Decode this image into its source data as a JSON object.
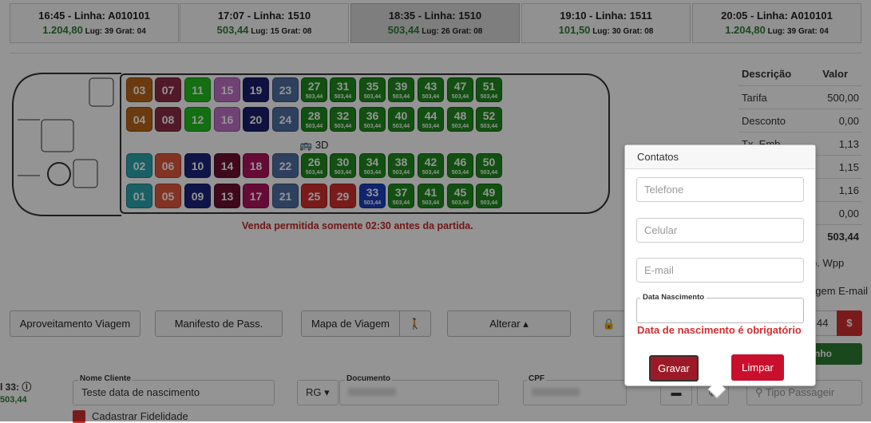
{
  "trips": [
    {
      "time_line": "16:45 - Linha: A010101",
      "price": "1.204,80",
      "lug": "39",
      "grat": "04",
      "active": false
    },
    {
      "time_line": "17:07 - Linha: 1510",
      "price": "503,44",
      "lug": "15",
      "grat": "08",
      "active": false
    },
    {
      "time_line": "18:35 - Linha: 1510",
      "price": "503,44",
      "lug": "26",
      "grat": "08",
      "active": true
    },
    {
      "time_line": "19:10 - Linha: 1511",
      "price": "101,50",
      "lug": "30",
      "grat": "08",
      "active": false
    },
    {
      "time_line": "20:05 - Linha: A010101",
      "price": "1.204,80",
      "lug": "39",
      "grat": "04",
      "active": false
    }
  ],
  "trip_labels": {
    "lug": "Lug:",
    "grat": "Grat:"
  },
  "seat_price": "503,44",
  "seats": [
    {
      "n": "03",
      "color": "#b8671a"
    },
    {
      "n": "04",
      "color": "#b8671a"
    },
    {
      "n": "07",
      "color": "#8e2d48"
    },
    {
      "n": "08",
      "color": "#8e2d48"
    },
    {
      "n": "11",
      "color": "#22c01e"
    },
    {
      "n": "12",
      "color": "#22c01e"
    },
    {
      "n": "15",
      "color": "#c173c8"
    },
    {
      "n": "16",
      "color": "#c173c8"
    },
    {
      "n": "19",
      "color": "#1a1f6e"
    },
    {
      "n": "20",
      "color": "#1a1f6e"
    },
    {
      "n": "23",
      "color": "#4f6fa3"
    },
    {
      "n": "24",
      "color": "#4f6fa3"
    },
    {
      "n": "02",
      "color": "#2aa6b0"
    },
    {
      "n": "01",
      "color": "#2aa6b0"
    },
    {
      "n": "06",
      "color": "#e2583e"
    },
    {
      "n": "05",
      "color": "#e2583e"
    },
    {
      "n": "10",
      "color": "#1a237e"
    },
    {
      "n": "09",
      "color": "#1a237e"
    },
    {
      "n": "14",
      "color": "#6d0f30"
    },
    {
      "n": "13",
      "color": "#6d0f30"
    },
    {
      "n": "18",
      "color": "#b0125e"
    },
    {
      "n": "17",
      "color": "#b0125e"
    },
    {
      "n": "22",
      "color": "#4f6fa3"
    },
    {
      "n": "21",
      "color": "#4f6fa3"
    },
    {
      "n": "25",
      "color": "#d32f2f"
    },
    {
      "n": "29",
      "color": "#d32f2f"
    },
    {
      "n": "33",
      "color": "#1e3fbf",
      "priced": true
    }
  ],
  "available_seats": [
    [
      "27",
      "31",
      "35",
      "39",
      "43",
      "47",
      "51"
    ],
    [
      "28",
      "32",
      "36",
      "40",
      "44",
      "48",
      "52"
    ],
    [
      "26",
      "30",
      "34",
      "38",
      "42",
      "46",
      "50"
    ],
    [
      "37",
      "41",
      "45",
      "49"
    ]
  ],
  "bus_label": "3D",
  "warning": "Venda permitida somente 02:30 antes da partida.",
  "price_table": {
    "head": [
      "Descrição",
      "Valor"
    ],
    "rows": [
      [
        "Tarifa",
        "500,00"
      ],
      [
        "Desconto",
        "0,00"
      ],
      [
        "Tx. Emb.",
        "1,13"
      ],
      [
        "",
        "1,15"
      ],
      [
        "",
        "1,16"
      ],
      [
        "",
        "0,00"
      ],
      [
        "",
        "503,44"
      ]
    ]
  },
  "buttons": {
    "aproveitamento": "Aproveitamento Viagem",
    "manifesto": "Manifesto de Pass.",
    "mapa": "Mapa de Viagem",
    "alterar": "Alterar",
    "gravar": "Gravar",
    "limpar": "Limpar"
  },
  "side_texts": {
    "wpp": "p. Wpp",
    "email": "agem E-mail",
    "price44": "44",
    "green_btn": "nho"
  },
  "passenger": {
    "seat_label": "l 33:",
    "seat_price": "503,44",
    "nome_label": "Nome Cliente",
    "nome_value": "Teste data de nascimento",
    "doc_type": "RG",
    "documento_label": "Documento",
    "cpf_label": "CPF",
    "tipo_placeholder": "Tipo Passageir",
    "fidelidade": "Cadastrar Fidelidade"
  },
  "contatos": {
    "title": "Contatos",
    "telefone": "Telefone",
    "celular": "Celular",
    "email": "E-mail",
    "nascimento_label": "Data Nascimento",
    "nascimento_error": "Data de nascimento é obrigatório"
  }
}
